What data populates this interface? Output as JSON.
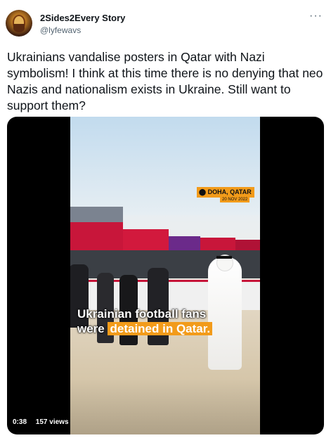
{
  "author": {
    "name": "2Sides2Every Story",
    "handle": "@lyfewavs",
    "avatar_icon": "avatar-portrait-icon"
  },
  "more_icon": "···",
  "tweet": {
    "text": "Ukrainians vandalise posters in Qatar with Nazi symbolism! I think at this time there is no denying that neo Nazis and nationalism exists in Ukraine. Still want to support them?"
  },
  "video": {
    "location": "DOHA, QATAR",
    "date": "20 NOV 2022",
    "caption_line1": "Ukrainian football fans",
    "caption_line2_prefix": "were",
    "caption_line2_highlight": "detained in Qatar.",
    "duration": "0:38",
    "views": "157 views",
    "accent_color": "#f29b1a"
  }
}
